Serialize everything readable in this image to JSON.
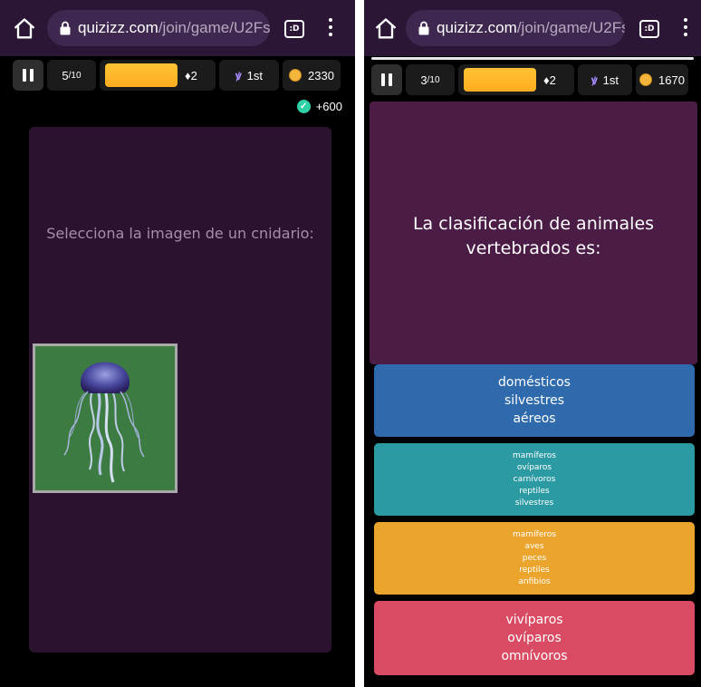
{
  "left": {
    "url": {
      "host": "quizizz.com",
      "path": "/join/game/U2Fs"
    },
    "tab_count": ":D",
    "hud": {
      "question": "5",
      "total": "/10",
      "streak": "2",
      "rank": "1st",
      "coins": "2330"
    },
    "bonus": "+600",
    "question": "Selecciona la imagen de un cnidario:",
    "option_image": "jellyfish-image",
    "colors": {
      "card": "#2b1330",
      "image_bg": "#3c7c43"
    }
  },
  "right": {
    "url": {
      "host": "quizizz.com",
      "path": "/join/game/U2Fs"
    },
    "tab_count": ":D",
    "hud": {
      "question": "3",
      "total": "/10",
      "streak": "2",
      "rank": "1st",
      "coins": "1670"
    },
    "question_line1": "La clasificación de animales",
    "question_line2": "vertebrados es:",
    "options": [
      {
        "color": "#2f6aad",
        "lines": [
          "domésticos",
          "silvestres",
          "aéreos"
        ]
      },
      {
        "color": "#2b9aa2",
        "lines": [
          "mamíferos",
          "ovíparos",
          "carnívoros",
          "reptiles",
          "silvestres"
        ]
      },
      {
        "color": "#eba52d",
        "lines": [
          "mamíferos",
          "aves",
          "peces",
          "reptiles",
          "anfibios"
        ]
      },
      {
        "color": "#d94b62",
        "lines": [
          "vivíparos",
          "ovíparos",
          "omnívoros"
        ]
      }
    ]
  }
}
